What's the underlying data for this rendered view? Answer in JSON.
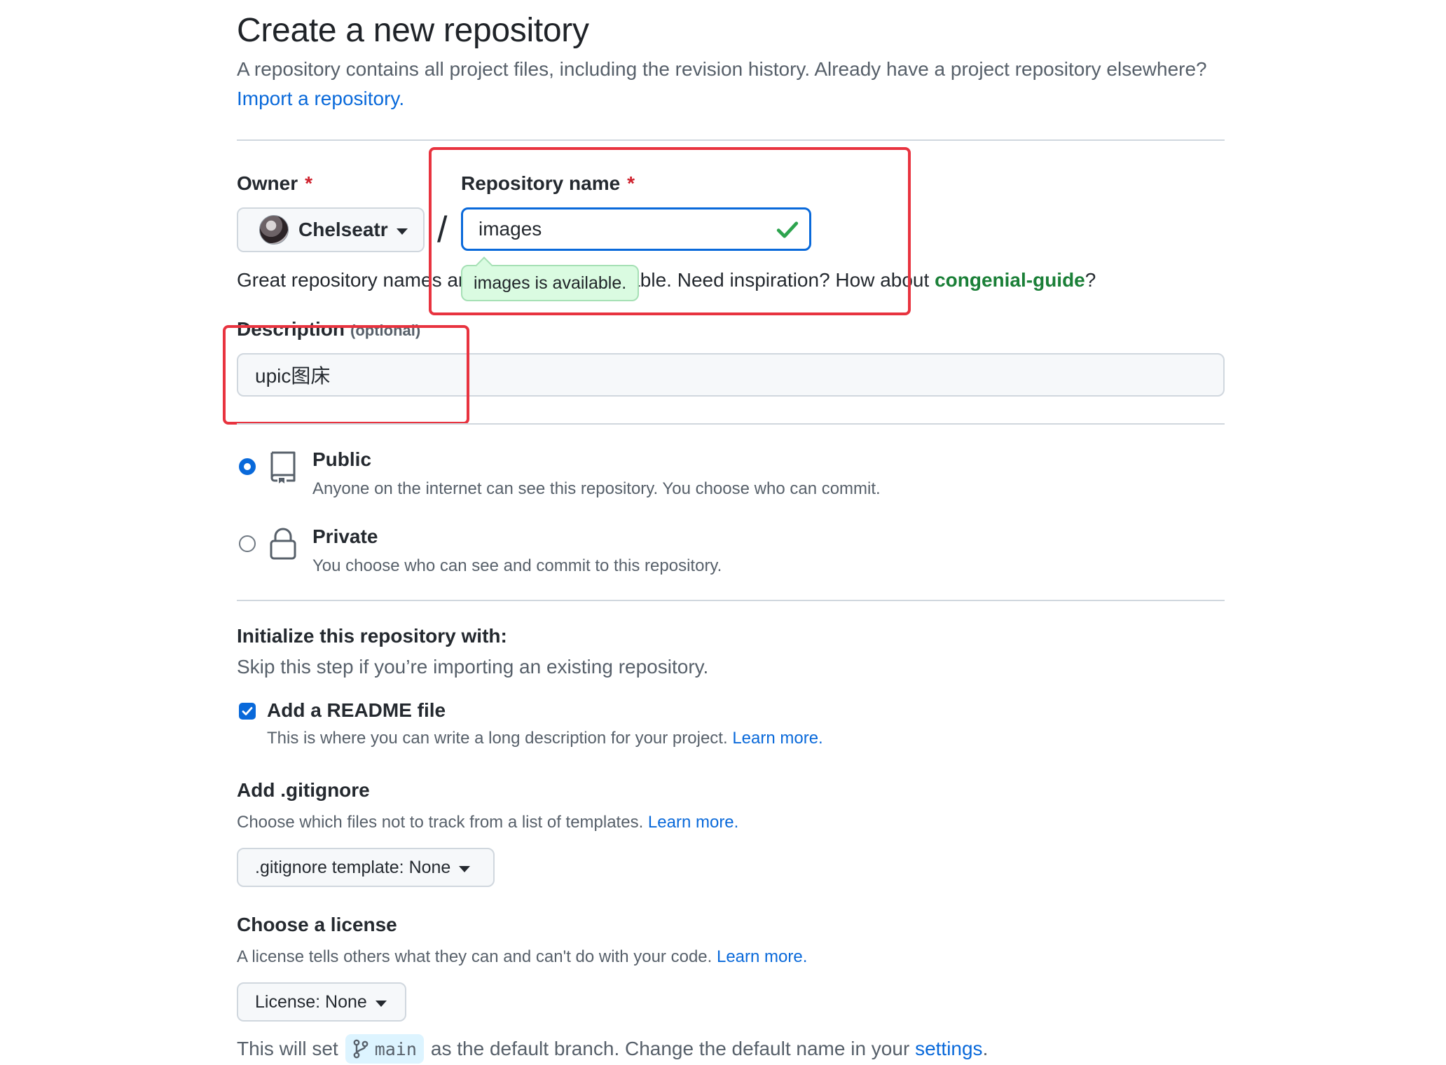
{
  "header": {
    "title": "Create a new repository",
    "subtitle": "A repository contains all project files, including the revision history. Already have a project repository elsewhere?",
    "import_link": "Import a repository."
  },
  "owner": {
    "label": "Owner",
    "required_mark": "*",
    "selected": "Chelseatr"
  },
  "slash": "/",
  "repo_name": {
    "label": "Repository name",
    "required_mark": "*",
    "value": "images",
    "availability_name": "images",
    "availability_text": "is available."
  },
  "hint": {
    "text_before": "Great repository names are short and memorable. Need inspiration? How about",
    "suggestion": "congenial-guide",
    "text_after": "?"
  },
  "description": {
    "label": "Description",
    "optional": "(optional)",
    "value": "upic图床"
  },
  "visibility": {
    "public": {
      "title": "Public",
      "desc": "Anyone on the internet can see this repository. You choose who can commit.",
      "selected": true
    },
    "private": {
      "title": "Private",
      "desc": "You choose who can see and commit to this repository.",
      "selected": false
    }
  },
  "init": {
    "title": "Initialize this repository with:",
    "subtitle": "Skip this step if you’re importing an existing repository.",
    "readme_label": "Add a README file",
    "readme_checked": true,
    "readme_desc": "This is where you can write a long description for your project.",
    "learn_more": "Learn more."
  },
  "gitignore": {
    "title": "Add .gitignore",
    "desc": "Choose which files not to track from a list of templates.",
    "learn_more": "Learn more.",
    "select_label": ".gitignore template: None"
  },
  "license": {
    "title": "Choose a license",
    "desc": "A license tells others what they can and can't do with your code.",
    "learn_more": "Learn more.",
    "select_label": "License: None"
  },
  "branch": {
    "prefix": "This will set",
    "name": "main",
    "middle": "as the default branch. Change the default name in your",
    "settings_link": "settings",
    "suffix": "."
  },
  "colors": {
    "link": "#0969da",
    "success": "#1a7f37",
    "annotation": "#e8333f",
    "required": "#cf222e"
  }
}
